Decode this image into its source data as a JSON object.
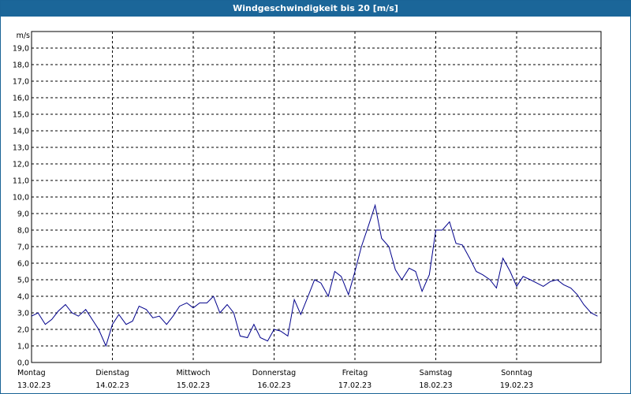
{
  "title": "Windgeschwindigkeit bis 20 [m/s]",
  "colors": {
    "titlebar": "#1b6699",
    "series": "#00008b",
    "grid": "#000000"
  },
  "chart_data": {
    "type": "line",
    "title": "Windgeschwindigkeit bis 20 [m/s]",
    "ylabel": "m/s",
    "ylim": [
      0,
      20
    ],
    "grid": true,
    "y_ticks": [
      "0,0",
      "1,0",
      "2,0",
      "3,0",
      "4,0",
      "5,0",
      "6,0",
      "7,0",
      "8,0",
      "9,0",
      "10,0",
      "11,0",
      "12,0",
      "13,0",
      "14,0",
      "15,0",
      "16,0",
      "17,0",
      "18,0",
      "19,0"
    ],
    "x_days": [
      {
        "day": "Montag",
        "date": "13.02.23"
      },
      {
        "day": "Dienstag",
        "date": "14.02.23"
      },
      {
        "day": "Mittwoch",
        "date": "15.02.23"
      },
      {
        "day": "Donnerstag",
        "date": "16.02.23"
      },
      {
        "day": "Freitag",
        "date": "17.02.23"
      },
      {
        "day": "Samstag",
        "date": "18.02.23"
      },
      {
        "day": "Sonntag",
        "date": "19.02.23"
      }
    ],
    "series": [
      {
        "x_days": [
          0,
          0.08,
          0.17,
          0.25,
          0.33,
          0.42,
          0.5,
          0.58,
          0.67,
          0.75,
          0.83,
          0.92,
          1.0,
          1.08,
          1.17,
          1.25,
          1.33,
          1.42,
          1.5,
          1.58,
          1.67,
          1.75,
          1.83,
          1.92,
          2.0,
          2.08,
          2.17,
          2.25,
          2.33,
          2.42,
          2.5,
          2.58,
          2.67,
          2.75,
          2.83,
          2.92,
          3.0,
          3.08,
          3.17,
          3.25,
          3.33,
          3.42,
          3.5,
          3.58,
          3.67,
          3.75,
          3.83,
          3.92,
          4.0,
          4.08,
          4.17,
          4.25,
          4.33,
          4.42,
          4.5,
          4.58,
          4.67,
          4.75,
          4.83,
          4.92,
          5.0,
          5.08,
          5.17,
          5.25,
          5.33,
          5.42,
          5.5,
          5.58,
          5.67,
          5.75,
          5.83,
          5.92,
          6.0,
          6.08,
          6.17,
          6.25,
          6.33,
          6.42,
          6.5,
          6.58,
          6.67,
          6.75,
          6.83,
          6.92,
          7.0
        ],
        "values": [
          2.8,
          3.0,
          2.3,
          2.6,
          3.1,
          3.5,
          3.0,
          2.8,
          3.2,
          2.6,
          2.0,
          1.0,
          2.3,
          2.9,
          2.3,
          2.5,
          3.4,
          3.2,
          2.7,
          2.8,
          2.3,
          2.8,
          3.4,
          3.6,
          3.3,
          3.6,
          3.6,
          4.0,
          3.0,
          3.5,
          3.0,
          1.6,
          1.5,
          2.3,
          1.5,
          1.3,
          2.0,
          1.9,
          1.6,
          3.8,
          2.9,
          4.0,
          5.0,
          4.8,
          4.0,
          5.5,
          5.2,
          4.1,
          5.5,
          7.0,
          8.3,
          9.5,
          7.5,
          7.0,
          5.6,
          5.0,
          5.7,
          5.5,
          4.3,
          5.3,
          8.0,
          8.0,
          8.5,
          7.2,
          7.1,
          6.3,
          5.5,
          5.3,
          5.0,
          4.5,
          6.3,
          5.5,
          4.6,
          5.2,
          5.0,
          4.8,
          4.6,
          4.9,
          5.0,
          4.7,
          4.5,
          4.1,
          3.5,
          3.0,
          2.8
        ]
      }
    ]
  }
}
